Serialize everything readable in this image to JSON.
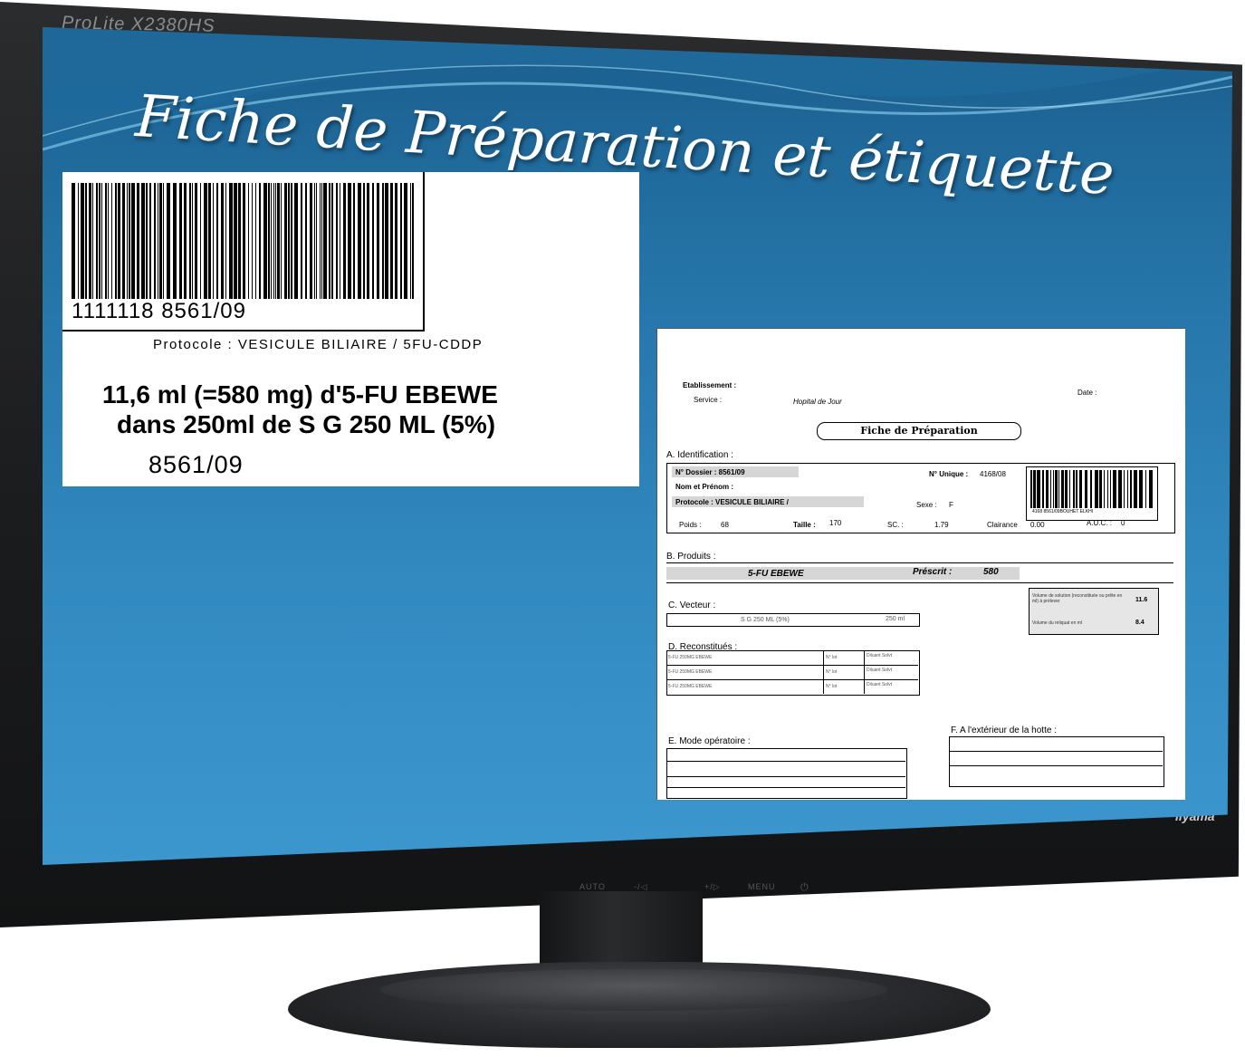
{
  "monitor": {
    "model": "ProLite X2380HS",
    "brand": "iiyama",
    "controls": [
      "AUTO",
      "-/◁",
      "+/▷",
      "MENU",
      "⏻"
    ]
  },
  "slide": {
    "title": "Fiche de Préparation et étiquette"
  },
  "label": {
    "barcode_number": "1111118 8561/09",
    "protocole": "Protocole : VESICULE BILIAIRE  /  5FU-CDDP",
    "dose_line1": "11,6 ml (=580 mg) d'5-FU EBEWE",
    "dose_line2": "dans 250ml de S G 250 ML (5%)",
    "code": "8561/09"
  },
  "sheet": {
    "etablissement_label": "Etablissement :",
    "service_label": "Service :",
    "service_value": "Hopital de Jour",
    "date_label": "Date :",
    "title": "Fiche de Préparation",
    "section_a": "A. Identification :",
    "dossier": "N° Dossier : 8561/09",
    "nom_prenom": "Nom et Prénom :",
    "protocole": "Protocole : VESICULE BILIAIRE /",
    "numero_unique_label": "N° Unique :",
    "numero_unique_value": "4168/08",
    "sexe_label": "Sexe :",
    "sexe_value": "F",
    "poids_label": "Poids :",
    "poids_value": "68",
    "taille_label": "Taille :",
    "taille_value": "170",
    "sc_label": "SC. :",
    "sc_value": "1.79",
    "clairance_label": "Clairance",
    "clairance_value": "0.00",
    "auc_label": "A.U.C. :",
    "auc_value": "0",
    "barcode_caption": "4168 8561/09BOUHET ELKHI",
    "section_b": "B. Produits :",
    "produit": "5-FU EBEWE",
    "prescrit_label": "Préscrit :",
    "prescrit_value": "580",
    "section_c": "C. Vecteur :",
    "vecteur": "S G 250 ML (5%)",
    "vecteur_volume": "250 ml",
    "volume_solution_label": "Volume de solution (reconstituée ou prête en ml) à prélever",
    "volume_solution_value": "11.6",
    "volume_reliquat_label": "Volume du reliquat en ml",
    "volume_reliquat_value": "8.4",
    "section_d": "D. Reconstitués :",
    "reconstitues": [
      {
        "product": "5-FU 250MG EBEWE",
        "lot": "N° lot",
        "diluant": "Diluant Solvt"
      },
      {
        "product": "5-FU 250MG EBEWE",
        "lot": "N° lot",
        "diluant": "Diluant Solvt"
      },
      {
        "product": "5-FU 250MG EBEWE",
        "lot": "N° lot",
        "diluant": "Diluant Solvt"
      }
    ],
    "section_e": "E. Mode opératoire :",
    "section_f": "F. A l'extérieur de la hotte :"
  }
}
